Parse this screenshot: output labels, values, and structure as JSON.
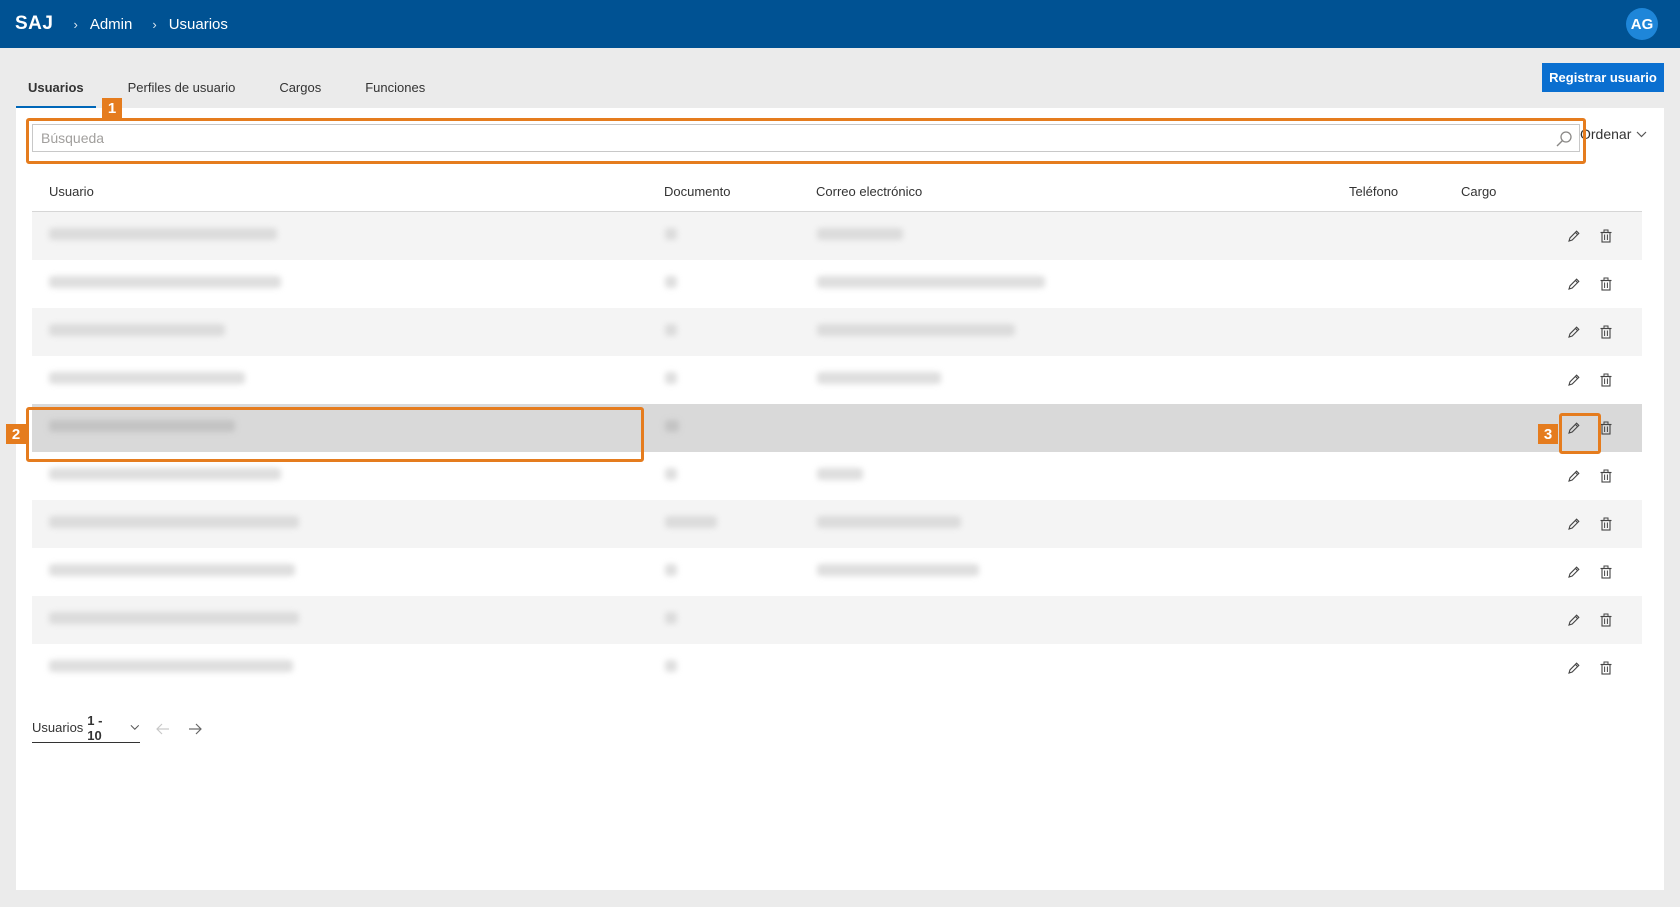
{
  "header": {
    "brand": "SAJ",
    "breadcrumb": [
      "Admin",
      "Usuarios"
    ],
    "avatar_initials": "AG",
    "bar_color": "#005293"
  },
  "tabs": [
    {
      "label": "Usuarios",
      "active": true
    },
    {
      "label": "Perfiles de usuario",
      "active": false
    },
    {
      "label": "Cargos",
      "active": false
    },
    {
      "label": "Funciones",
      "active": false
    }
  ],
  "actions": {
    "register_label": "Registrar usuario"
  },
  "search": {
    "placeholder": "Búsqueda",
    "value": ""
  },
  "sort": {
    "label": "Ordenar"
  },
  "table": {
    "columns": [
      "Usuario",
      "Documento",
      "Correo electrónico",
      "Teléfono",
      "Cargo"
    ],
    "row_count": 10,
    "selected_row": 5,
    "cells_redacted": true
  },
  "pagination": {
    "label": "Usuarios",
    "range": "1 - 10"
  },
  "callouts": [
    "1",
    "2",
    "3"
  ],
  "icons": [
    "search-icon",
    "chevron-down-icon",
    "pencil-icon",
    "trash-icon",
    "arrow-left-icon",
    "arrow-right-icon"
  ],
  "accent_color": "#e57c1e"
}
